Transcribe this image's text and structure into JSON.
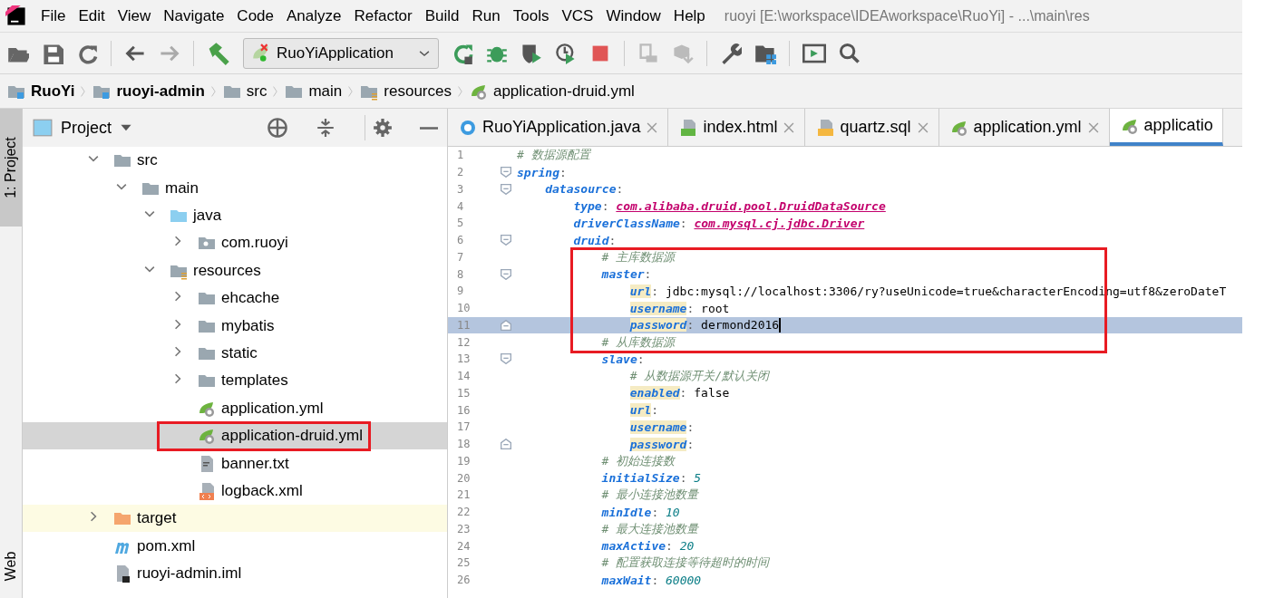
{
  "menu": [
    "File",
    "Edit",
    "View",
    "Navigate",
    "Code",
    "Analyze",
    "Refactor",
    "Build",
    "Run",
    "Tools",
    "VCS",
    "Window",
    "Help"
  ],
  "window": {
    "title": "ruoyi [E:\\workspace\\IDEAworkspace\\RuoYi] - ...\\main\\res"
  },
  "toolbar": {
    "run_config": "RuoYiApplication"
  },
  "breadcrumbs": [
    {
      "label": "RuoYi",
      "bold": true,
      "kind": "module"
    },
    {
      "label": "ruoyi-admin",
      "bold": true,
      "kind": "module"
    },
    {
      "label": "src",
      "bold": false,
      "kind": "folder"
    },
    {
      "label": "main",
      "bold": false,
      "kind": "folder"
    },
    {
      "label": "resources",
      "bold": false,
      "kind": "resources"
    },
    {
      "label": "application-druid.yml",
      "bold": false,
      "kind": "spring"
    }
  ],
  "side_stripe": {
    "top": "1: Project",
    "bottom": "Web"
  },
  "project_panel": {
    "title": "Project",
    "tree": [
      {
        "label": "src",
        "kind": "folder",
        "expanded": true,
        "children": [
          {
            "label": "main",
            "kind": "folder",
            "expanded": true,
            "children": [
              {
                "label": "java",
                "kind": "source",
                "expanded": true,
                "children": [
                  {
                    "label": "com.ruoyi",
                    "kind": "package",
                    "expanded": false
                  }
                ]
              },
              {
                "label": "resources",
                "kind": "resources",
                "expanded": true,
                "children": [
                  {
                    "label": "ehcache",
                    "kind": "folder",
                    "expanded": false
                  },
                  {
                    "label": "mybatis",
                    "kind": "folder",
                    "expanded": false
                  },
                  {
                    "label": "static",
                    "kind": "folder",
                    "expanded": false
                  },
                  {
                    "label": "templates",
                    "kind": "folder",
                    "expanded": false
                  },
                  {
                    "label": "application.yml",
                    "kind": "spring",
                    "selected": false,
                    "annotated": false
                  },
                  {
                    "label": "application-druid.yml",
                    "kind": "spring",
                    "selected": true,
                    "annotated": true
                  },
                  {
                    "label": "banner.txt",
                    "kind": "text",
                    "selected": false,
                    "annotated": false
                  },
                  {
                    "label": "logback.xml",
                    "kind": "xml",
                    "selected": false,
                    "annotated": false
                  }
                ]
              }
            ]
          }
        ]
      },
      {
        "label": "target",
        "kind": "excluded",
        "expanded": false
      },
      {
        "label": "pom.xml",
        "kind": "maven",
        "selected": false,
        "annotated": false
      },
      {
        "label": "ruoyi-admin.iml",
        "kind": "iml",
        "selected": false,
        "annotated": false
      }
    ]
  },
  "tabs": [
    {
      "label": "RuoYiApplication.java",
      "kind": "java",
      "selected": false
    },
    {
      "label": "index.html",
      "kind": "html",
      "selected": false
    },
    {
      "label": "quartz.sql",
      "kind": "sql",
      "selected": false
    },
    {
      "label": "application.yml",
      "kind": "spring",
      "selected": false
    },
    {
      "label": "applicatio",
      "kind": "spring",
      "selected": true
    }
  ],
  "editor": {
    "lines": [
      {
        "num": "1",
        "parts": [
          {
            "kind": "comment",
            "text": "# 数据源配置"
          }
        ]
      },
      {
        "num": "2",
        "fold_start": true,
        "parts": [
          {
            "kind": "key",
            "text": "spring"
          },
          {
            "kind": "punct",
            "text": ":"
          }
        ],
        "children": [
          {
            "num": "3",
            "fold_start": true,
            "parts": [
              {
                "kind": "key",
                "text": "datasource"
              },
              {
                "kind": "punct",
                "text": ":"
              }
            ],
            "children": [
              {
                "num": "4",
                "parts": [
                  {
                    "kind": "key",
                    "text": "type"
                  },
                  {
                    "kind": "punct",
                    "text": ": "
                  },
                  {
                    "kind": "class",
                    "text": "com.alibaba.druid.pool.DruidDataSource"
                  }
                ]
              },
              {
                "num": "5",
                "parts": [
                  {
                    "kind": "key",
                    "text": "driverClassName"
                  },
                  {
                    "kind": "punct",
                    "text": ": "
                  },
                  {
                    "kind": "class",
                    "text": "com.mysql.cj.jdbc.Driver"
                  }
                ]
              },
              {
                "num": "6",
                "fold_start": true,
                "parts": [
                  {
                    "kind": "key",
                    "text": "druid"
                  },
                  {
                    "kind": "punct",
                    "text": ":"
                  }
                ],
                "children": [
                  {
                    "num": "7",
                    "annotated": true,
                    "parts": [
                      {
                        "kind": "comment",
                        "text": "# 主库数据源"
                      }
                    ]
                  },
                  {
                    "num": "8",
                    "annotated": true,
                    "fold_start": true,
                    "parts": [
                      {
                        "kind": "key",
                        "text": "master"
                      },
                      {
                        "kind": "punct",
                        "text": ":"
                      }
                    ],
                    "children": [
                      {
                        "num": "9",
                        "annotated": true,
                        "parts": [
                          {
                            "kind": "key",
                            "text": "url",
                            "marked": true
                          },
                          {
                            "kind": "punct",
                            "text": ": "
                          },
                          {
                            "kind": "value",
                            "text": "jdbc:mysql://localhost:3306/ry?useUnicode=true&characterEncoding=utf8&zeroDateT"
                          }
                        ]
                      },
                      {
                        "num": "10",
                        "annotated": true,
                        "parts": [
                          {
                            "kind": "key",
                            "text": "username",
                            "marked": true
                          },
                          {
                            "kind": "punct",
                            "text": ": "
                          },
                          {
                            "kind": "value",
                            "text": "root"
                          }
                        ]
                      },
                      {
                        "num": "11",
                        "annotated": true,
                        "current": true,
                        "fold_end": true,
                        "parts": [
                          {
                            "kind": "key",
                            "text": "password",
                            "marked": true
                          },
                          {
                            "kind": "punct",
                            "text": ": "
                          },
                          {
                            "kind": "value",
                            "text": "dermond2016"
                          }
                        ]
                      }
                    ]
                  },
                  {
                    "num": "12",
                    "annotated": true,
                    "parts": [
                      {
                        "kind": "comment",
                        "text": "# 从库数据源"
                      }
                    ]
                  },
                  {
                    "num": "13",
                    "fold_start": true,
                    "parts": [
                      {
                        "kind": "key",
                        "text": "slave"
                      },
                      {
                        "kind": "punct",
                        "text": ":"
                      }
                    ],
                    "children": [
                      {
                        "num": "14",
                        "parts": [
                          {
                            "kind": "comment",
                            "text": "# 从数据源开关/默认关闭"
                          }
                        ]
                      },
                      {
                        "num": "15",
                        "parts": [
                          {
                            "kind": "key",
                            "text": "enabled",
                            "marked": true
                          },
                          {
                            "kind": "punct",
                            "text": ": "
                          },
                          {
                            "kind": "value",
                            "text": "false"
                          }
                        ]
                      },
                      {
                        "num": "16",
                        "parts": [
                          {
                            "kind": "key",
                            "text": "url",
                            "marked": true
                          },
                          {
                            "kind": "punct",
                            "text": ":"
                          }
                        ]
                      },
                      {
                        "num": "17",
                        "parts": [
                          {
                            "kind": "key",
                            "text": "username",
                            "marked": true
                          },
                          {
                            "kind": "punct",
                            "text": ":"
                          }
                        ]
                      },
                      {
                        "num": "18",
                        "fold_end": true,
                        "parts": [
                          {
                            "kind": "key",
                            "text": "password",
                            "marked": true
                          },
                          {
                            "kind": "punct",
                            "text": ":"
                          }
                        ]
                      }
                    ]
                  },
                  {
                    "num": "19",
                    "parts": [
                      {
                        "kind": "comment",
                        "text": "# 初始连接数"
                      }
                    ]
                  },
                  {
                    "num": "20",
                    "parts": [
                      {
                        "kind": "key",
                        "text": "initialSize"
                      },
                      {
                        "kind": "punct",
                        "text": ": "
                      },
                      {
                        "kind": "number",
                        "text": "5"
                      }
                    ]
                  },
                  {
                    "num": "21",
                    "parts": [
                      {
                        "kind": "comment",
                        "text": "# 最小连接池数量"
                      }
                    ]
                  },
                  {
                    "num": "22",
                    "parts": [
                      {
                        "kind": "key",
                        "text": "minIdle"
                      },
                      {
                        "kind": "punct",
                        "text": ": "
                      },
                      {
                        "kind": "number",
                        "text": "10"
                      }
                    ]
                  },
                  {
                    "num": "23",
                    "parts": [
                      {
                        "kind": "comment",
                        "text": "# 最大连接池数量"
                      }
                    ]
                  },
                  {
                    "num": "24",
                    "parts": [
                      {
                        "kind": "key",
                        "text": "maxActive"
                      },
                      {
                        "kind": "punct",
                        "text": ": "
                      },
                      {
                        "kind": "number",
                        "text": "20"
                      }
                    ]
                  },
                  {
                    "num": "25",
                    "parts": [
                      {
                        "kind": "comment",
                        "text": "# 配置获取连接等待超时的时间"
                      }
                    ]
                  },
                  {
                    "num": "26",
                    "parts": [
                      {
                        "kind": "key",
                        "text": "maxWait"
                      },
                      {
                        "kind": "punct",
                        "text": ": "
                      },
                      {
                        "kind": "number",
                        "text": "60000"
                      }
                    ]
                  }
                ]
              }
            ]
          }
        ]
      }
    ]
  }
}
